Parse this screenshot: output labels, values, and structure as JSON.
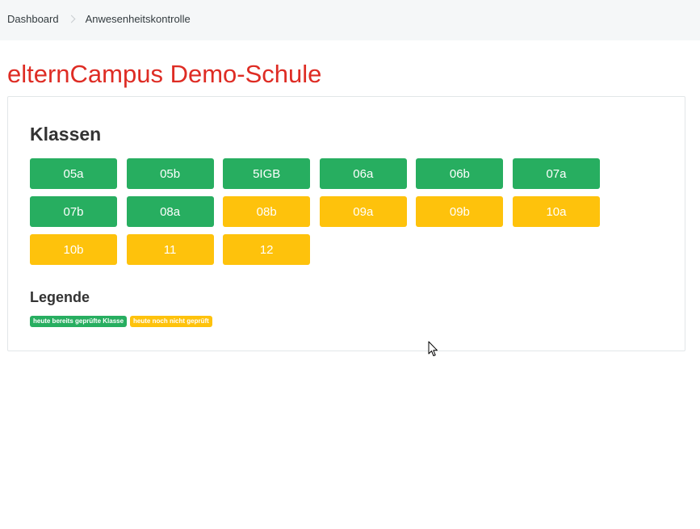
{
  "breadcrumb": {
    "items": [
      {
        "label": "Dashboard"
      },
      {
        "label": "Anwesenheitskontrolle"
      }
    ]
  },
  "page": {
    "title": "elternCampus Demo-Schule"
  },
  "classes": {
    "heading": "Klassen",
    "items": [
      {
        "label": "05a",
        "status": "checked"
      },
      {
        "label": "05b",
        "status": "checked"
      },
      {
        "label": "5IGB",
        "status": "checked"
      },
      {
        "label": "06a",
        "status": "checked"
      },
      {
        "label": "06b",
        "status": "checked"
      },
      {
        "label": "07a",
        "status": "checked"
      },
      {
        "label": "07b",
        "status": "checked"
      },
      {
        "label": "08a",
        "status": "checked"
      },
      {
        "label": "08b",
        "status": "unchecked"
      },
      {
        "label": "09a",
        "status": "unchecked"
      },
      {
        "label": "09b",
        "status": "unchecked"
      },
      {
        "label": "10a",
        "status": "unchecked"
      },
      {
        "label": "10b",
        "status": "unchecked"
      },
      {
        "label": "11",
        "status": "unchecked"
      },
      {
        "label": "12",
        "status": "unchecked"
      }
    ]
  },
  "legend": {
    "heading": "Legende",
    "checked_label": "heute bereits geprüfte Klasse",
    "unchecked_label": "heute noch nicht geprüft"
  },
  "colors": {
    "title": "#de2c24",
    "checked": "#27ae60",
    "unchecked": "#fec20c",
    "breadcrumb_bg": "#f5f7f8"
  },
  "icons": {
    "breadcrumb_separator": "chevron-right-icon",
    "cursor": "mouse-pointer-icon"
  }
}
